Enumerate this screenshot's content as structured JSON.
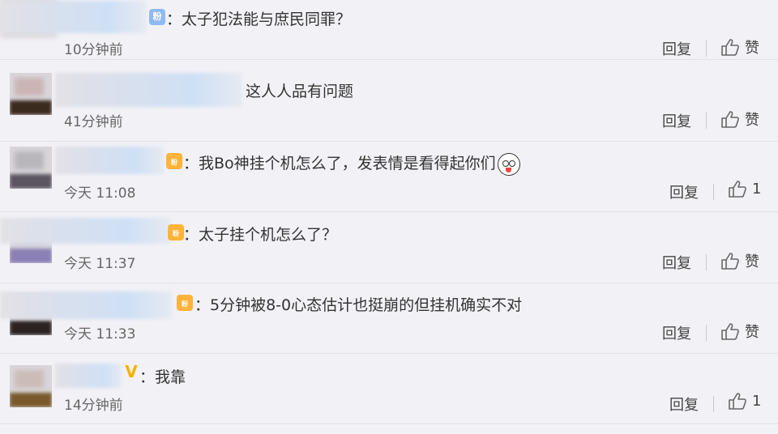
{
  "comments": [
    {
      "badge": "粉",
      "text": "：太子犯法能与庶民同罪？",
      "time": "10分钟前",
      "reply": "回复",
      "likes": "赞"
    },
    {
      "badge": "",
      "text": "这人人品有问题",
      "time": "41分钟前",
      "reply": "回复",
      "likes": "赞"
    },
    {
      "badge": "fan",
      "text": "：我Bo神挂个机怎么了，发表情是看得起你们",
      "time": "今天 11:08",
      "reply": "回复",
      "likes": "1"
    },
    {
      "badge": "fan",
      "text": "：太子挂个机怎么了？",
      "time": "今天 11:37",
      "reply": "回复",
      "likes": "赞"
    },
    {
      "badge": "fan",
      "text": "：5分钟被8-0心态估计也挺崩的但挂机确实不对",
      "time": "今天 11:33",
      "reply": "回复",
      "likes": "赞"
    },
    {
      "badge": "V",
      "text": "：我靠",
      "time": "14分钟前",
      "reply": "回复",
      "likes": "1"
    }
  ],
  "colors": {
    "background": "#f2f1f6",
    "fan_badge": "#ffb33a",
    "verified": "#f6b100"
  }
}
